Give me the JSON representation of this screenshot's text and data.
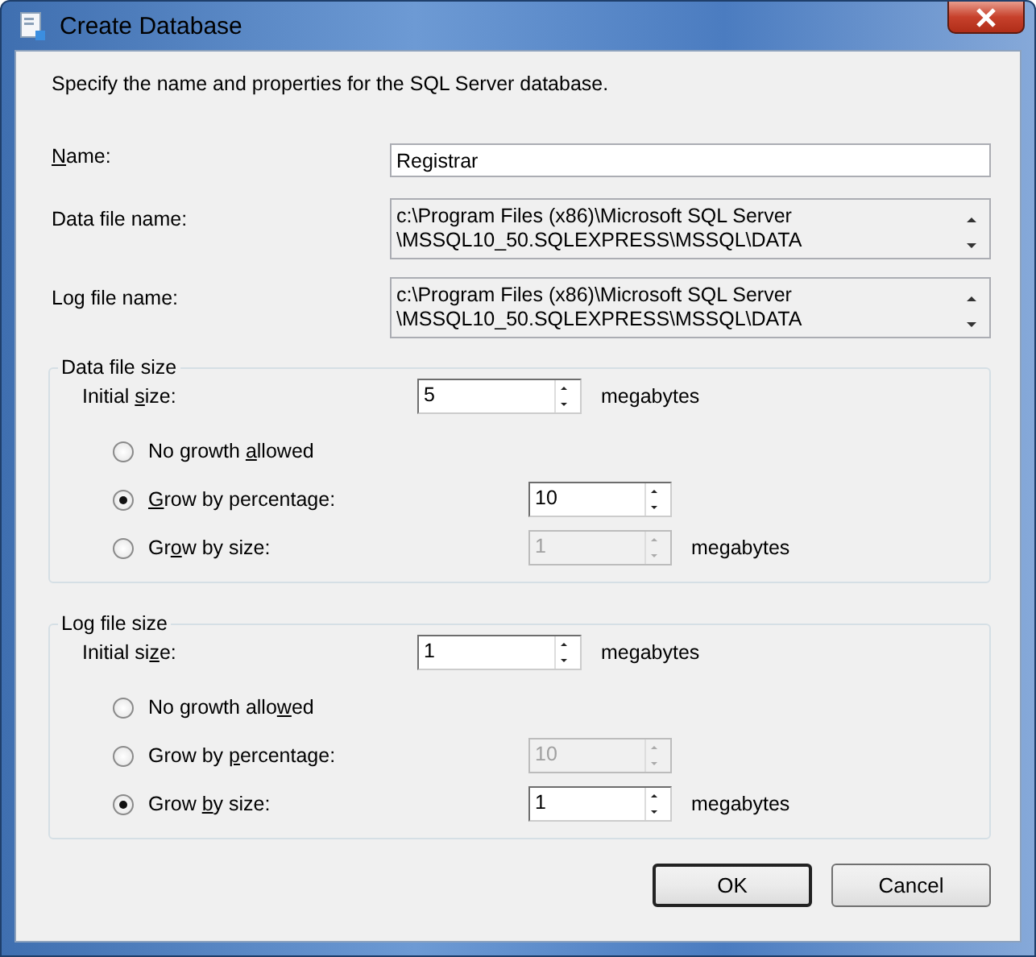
{
  "window": {
    "title": "Create Database"
  },
  "description": "Specify the name and properties for the SQL Server database.",
  "name": {
    "label": {
      "key": "N",
      "after": "ame:"
    },
    "value": "Registrar"
  },
  "data_file": {
    "label": "Data file name:",
    "lines": [
      "c:\\Program Files (x86)\\Microsoft SQL Server",
      "\\MSSQL10_50.SQLEXPRESS\\MSSQL\\DATA"
    ]
  },
  "log_file": {
    "label": "Log file name:",
    "lines": [
      "c:\\Program Files (x86)\\Microsoft SQL Server",
      "\\MSSQL10_50.SQLEXPRESS\\MSSQL\\DATA"
    ]
  },
  "groups": [
    {
      "title": "Data file size",
      "initial": {
        "label": {
          "before": "Initial ",
          "key": "s",
          "after": "ize:"
        },
        "value": "5",
        "unit": "megabytes"
      },
      "options": [
        {
          "label": {
            "before": "No growth ",
            "key": "a",
            "after": "llowed"
          },
          "selected": false
        },
        {
          "label": {
            "key": "G",
            "after": "row by percentage:"
          },
          "selected": true,
          "spinner": {
            "value": "10",
            "disabled": false
          }
        },
        {
          "label": {
            "before": "Gr",
            "key": "o",
            "after": "w by size:"
          },
          "selected": false,
          "spinner": {
            "value": "1",
            "disabled": true
          },
          "unit": "megabytes"
        }
      ]
    },
    {
      "title": "Log file size",
      "initial": {
        "label": {
          "before": "Initial si",
          "key": "z",
          "after": "e:"
        },
        "value": "1",
        "unit": "megabytes"
      },
      "options": [
        {
          "label": {
            "before": "No growth allo",
            "key": "w",
            "after": "ed"
          },
          "selected": false
        },
        {
          "label": {
            "before": "Grow by ",
            "key": "p",
            "after": "ercentage:"
          },
          "selected": false,
          "spinner": {
            "value": "10",
            "disabled": true
          }
        },
        {
          "label": {
            "before": "Grow ",
            "key": "b",
            "after": "y size:"
          },
          "selected": true,
          "spinner": {
            "value": "1",
            "disabled": false
          },
          "unit": "megabytes"
        }
      ]
    }
  ],
  "buttons": [
    {
      "label": "OK",
      "default": true
    },
    {
      "label": "Cancel",
      "default": false
    }
  ]
}
